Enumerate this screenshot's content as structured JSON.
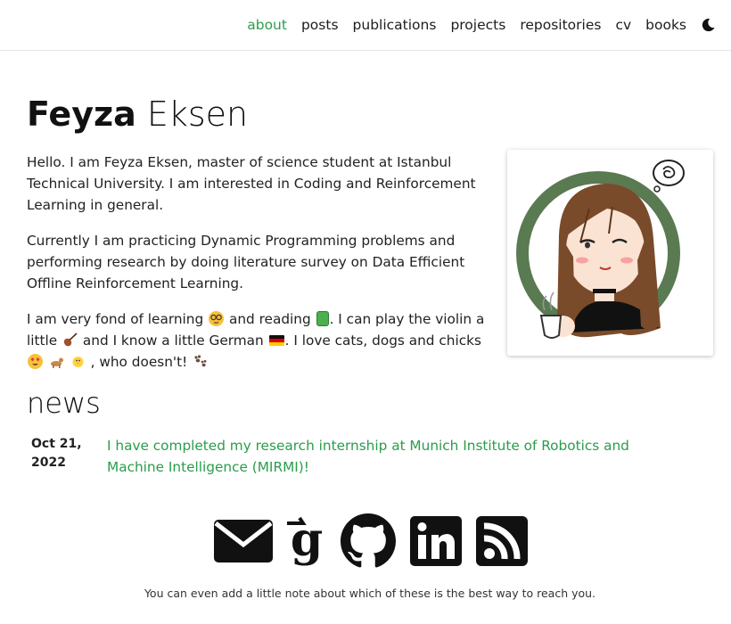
{
  "nav": {
    "items": [
      {
        "label": "about",
        "active": true
      },
      {
        "label": "posts"
      },
      {
        "label": "publications"
      },
      {
        "label": "projects"
      },
      {
        "label": "repositories"
      },
      {
        "label": "cv"
      },
      {
        "label": "books"
      }
    ],
    "theme_toggle_icon": "moon-icon",
    "active_color": "#2a9d4b"
  },
  "header": {
    "first_name": "Feyza",
    "last_name": "Eksen"
  },
  "bio": {
    "p1": "Hello. I am Feyza Eksen, master of science student at Istanbul Technical University. I am interested in Coding and Reinforcement Learning in general.",
    "p2": "Currently I am practicing Dynamic Programming problems and performing research by doing literature survey on Data Efficient Offline Reinforcement Learning.",
    "p3_a": "I am very fond of learning",
    "p3_b": "and reading",
    "p3_c": ". I can play the violin a little",
    "p3_d": "and I know a little German",
    "p3_e": ". I love cats, dogs and chicks",
    "p3_f": ", who doesn't!",
    "emojis": [
      "nerd-face-icon",
      "green-book-icon",
      "violin-icon",
      "german-flag-icon",
      "heart-eyes-icon",
      "dog-icon",
      "chick-icon",
      "paw-prints-icon"
    ]
  },
  "profile": {
    "image": "illustrated-portrait-avatar",
    "ring_color": "#5a7a52"
  },
  "news": {
    "heading": "news",
    "items": [
      {
        "date": "Oct 21, 2022",
        "text": "I have completed my research internship at Munich Institute of Robotics and Machine Intelligence (MIRMI)!"
      }
    ]
  },
  "social": {
    "icons": [
      "envelope-icon",
      "google-scholar-icon",
      "github-icon",
      "linkedin-icon",
      "rss-icon"
    ],
    "note": "You can even add a little note about which of these is the best way to reach you."
  }
}
